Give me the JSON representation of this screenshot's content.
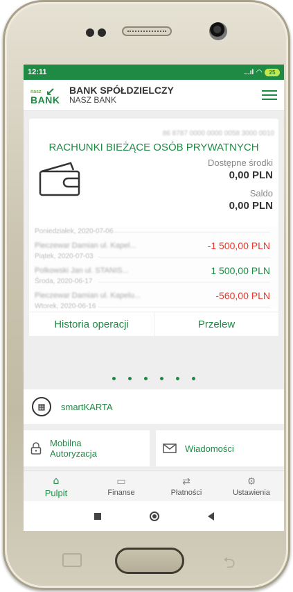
{
  "status_bar": {
    "time": "12:11",
    "signal": "...ıl",
    "battery": "25"
  },
  "header": {
    "logo_small": "nasz",
    "logo_main": "BANK",
    "bank_name_line1": "BANK SPÓŁDZIELCZY",
    "bank_name_line2": "NASZ BANK",
    "menu_icon": "hamburger-icon"
  },
  "account": {
    "number": "86 8787 0000 0000 0058 3000 0010",
    "title": "RACHUNKI BIEŻĄCE OSÓB PRYWATNYCH",
    "available_label": "Dostępne środki",
    "available_value": "0,00 PLN",
    "balance_label": "Saldo",
    "balance_value": "0,00 PLN",
    "operations": [
      {
        "date": "Poniedziałek, 2020-07-06",
        "title": "Pieczewar Damian ul. Kapel...",
        "amount": "-1 500,00 PLN",
        "type": "debit"
      },
      {
        "date": "Piątek, 2020-07-03",
        "title": "Polkowski Jan ul. STANIS...",
        "amount": "1 500,00 PLN",
        "type": "credit"
      },
      {
        "date": "Środa, 2020-06-17",
        "title": "Pieczewar Damian ul. Kapelu...",
        "amount": "-560,00 PLN",
        "type": "debit"
      },
      {
        "date": "Wtorek, 2020-06-16",
        "title": "",
        "amount": "",
        "type": ""
      }
    ],
    "history_button": "Historia operacji",
    "transfer_button": "Przelew"
  },
  "carousel": {
    "page_count": 6,
    "active_index": 0
  },
  "tiles": {
    "smartkarta": "smartKARTA",
    "mobile_auth_line1": "Mobilna",
    "mobile_auth_line2": "Autoryzacja",
    "messages": "Wiadomości"
  },
  "bottom_nav": [
    {
      "label": "Pulpit",
      "icon": "home-icon",
      "active": true
    },
    {
      "label": "Finanse",
      "icon": "wallet-icon",
      "active": false
    },
    {
      "label": "Płatności",
      "icon": "transfer-arrows-icon",
      "active": false
    },
    {
      "label": "Ustawienia",
      "icon": "gear-icon",
      "active": false
    }
  ],
  "colors": {
    "brand_green": "#1e8a44",
    "negative": "#e23a2e",
    "background": "#eeeeee"
  }
}
